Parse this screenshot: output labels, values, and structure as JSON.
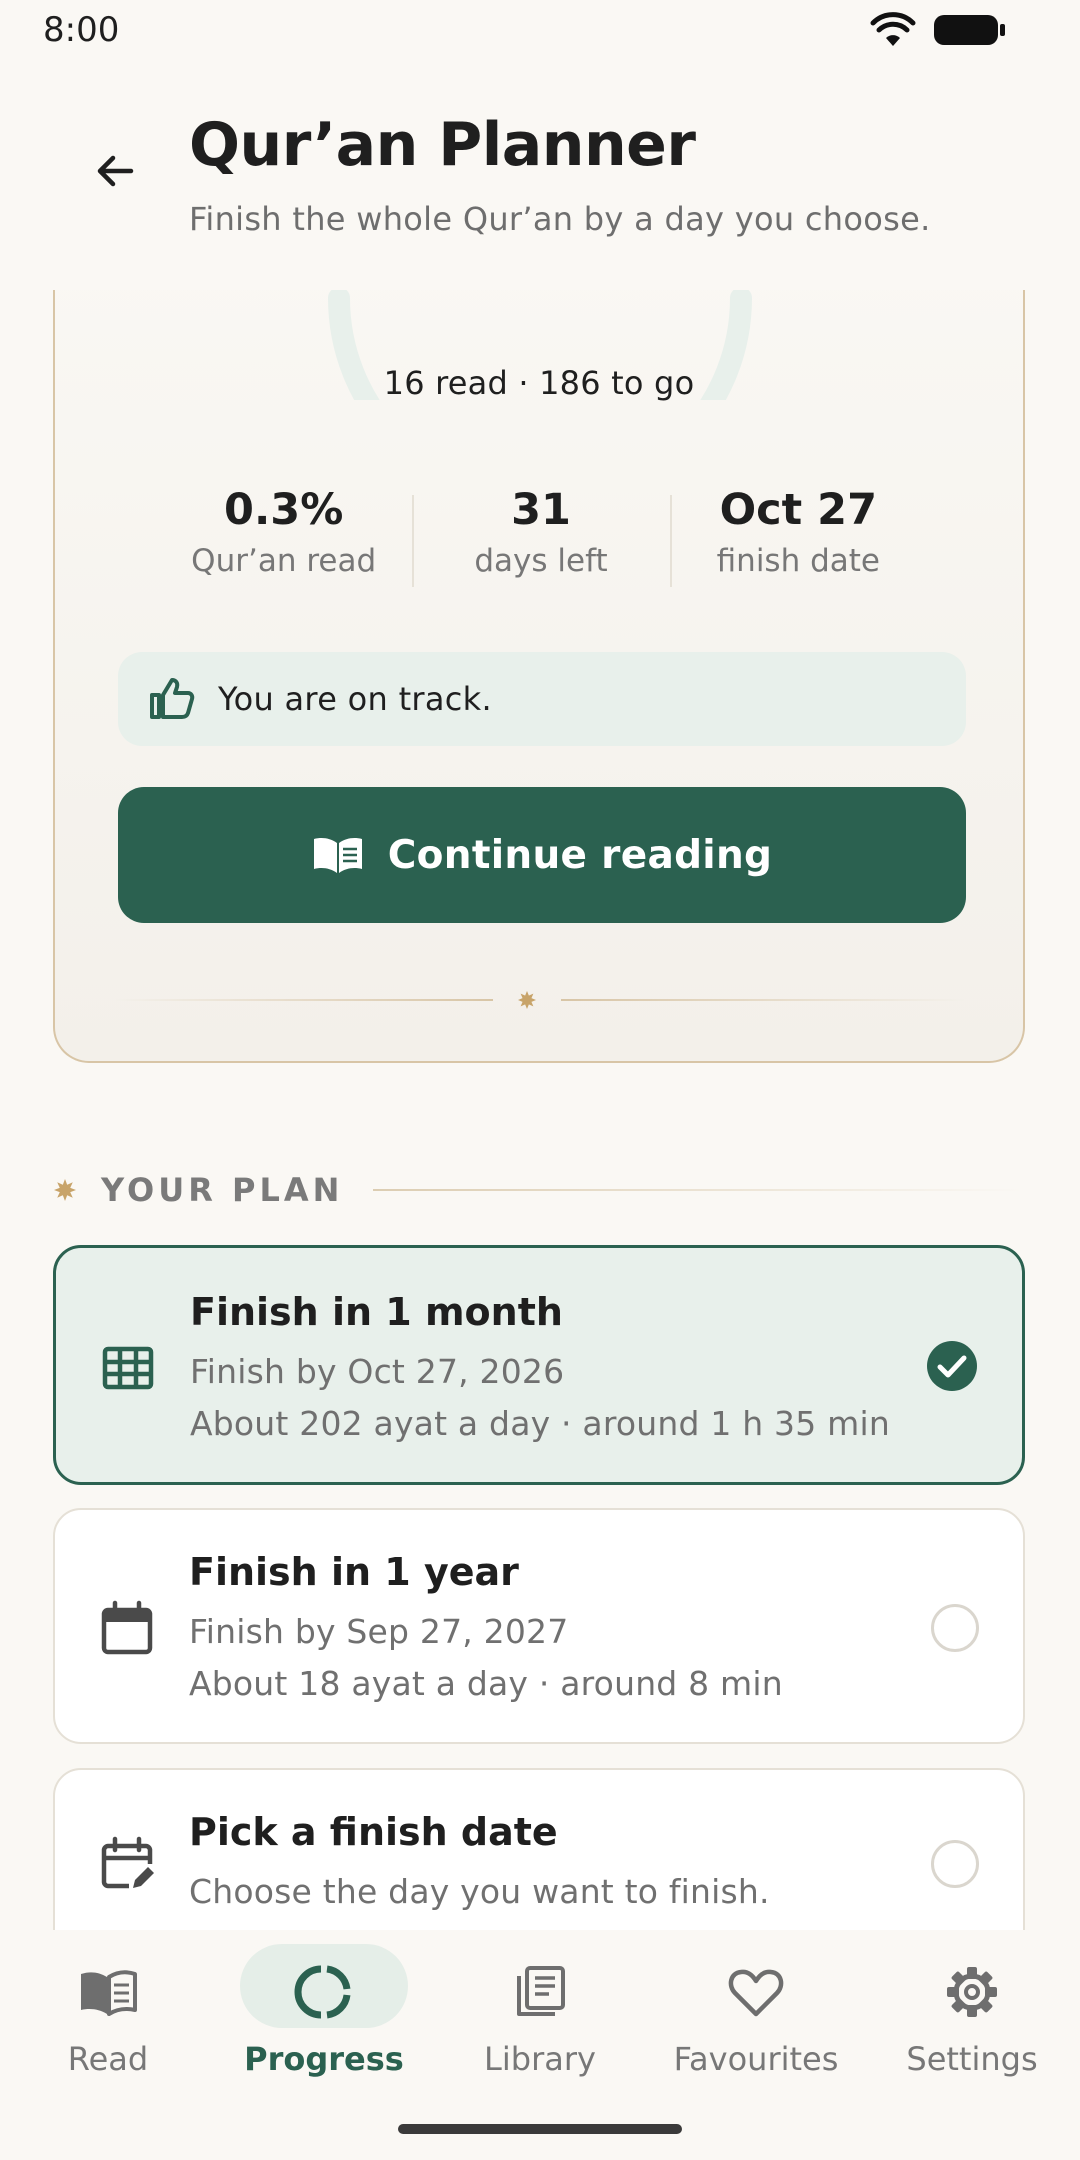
{
  "status_bar": {
    "time": "8:00"
  },
  "header": {
    "title": "Qur’an Planner",
    "subtitle": "Finish the whole Qur’an by a day you choose."
  },
  "progress": {
    "summary": "16 read · 186 to go",
    "stats": [
      {
        "value": "0.3%",
        "label": "Qur’an read"
      },
      {
        "value": "31",
        "label": "days left"
      },
      {
        "value": "Oct 27",
        "label": "finish date"
      }
    ],
    "track_status": "You are on track.",
    "continue_label": "Continue reading"
  },
  "plan_section": {
    "heading": "YOUR PLAN",
    "options": [
      {
        "title": "Finish in 1 month",
        "line1": "Finish by Oct 27, 2026",
        "line2": "About 202 ayat a day · around 1 h 35 min",
        "selected": true,
        "icon": "grid-icon"
      },
      {
        "title": "Finish in 1 year",
        "line1": "Finish by Sep 27, 2027",
        "line2": "About 18 ayat a day · around 8 min",
        "selected": false,
        "icon": "calendar-icon"
      },
      {
        "title": "Pick a finish date",
        "line1": "Choose the day you want to finish.",
        "selected": false,
        "icon": "calendar-edit-icon"
      }
    ]
  },
  "bottom_nav": {
    "items": [
      {
        "label": "Read",
        "icon": "book-icon"
      },
      {
        "label": "Progress",
        "icon": "progress-ring-icon",
        "active": true
      },
      {
        "label": "Library",
        "icon": "library-icon"
      },
      {
        "label": "Favourites",
        "icon": "heart-icon"
      },
      {
        "label": "Settings",
        "icon": "gear-icon"
      }
    ]
  },
  "colors": {
    "accent": "#2B6150",
    "accent_soft": "#E8F0EB",
    "card_border": "#D8C5A6",
    "ornament_gold": "#C8A46A",
    "background": "#FAF8F4"
  }
}
